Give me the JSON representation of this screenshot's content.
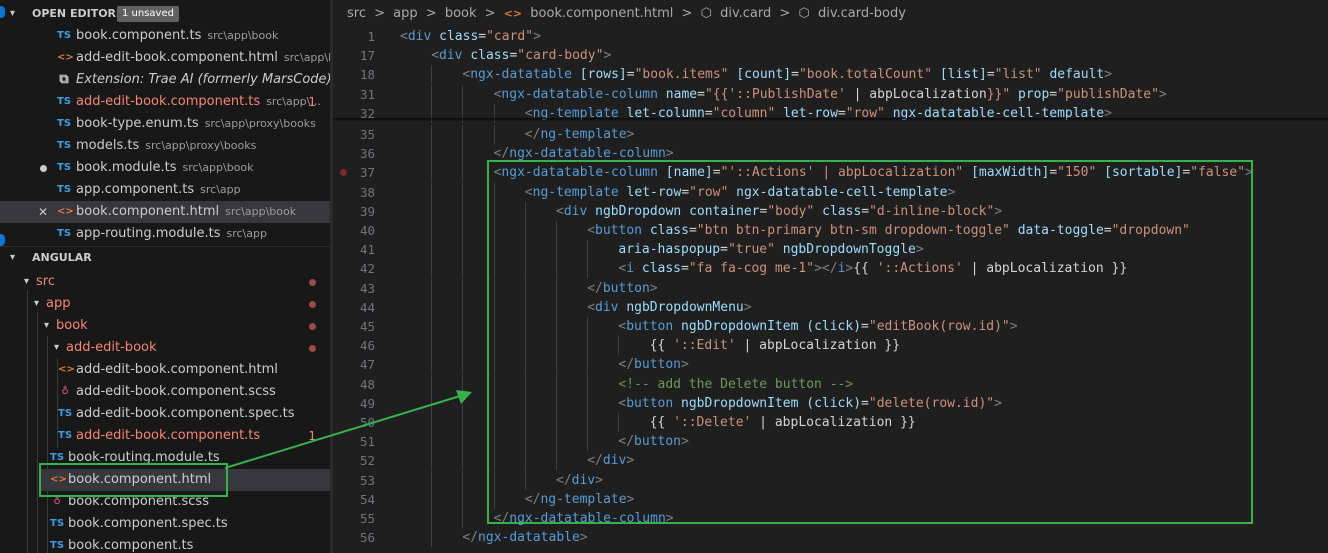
{
  "sidebar": {
    "open_editors": {
      "title": "OPEN EDITORS",
      "badge": "1 unsaved",
      "items": [
        {
          "icon": "TS",
          "type": "ts",
          "name": "book.component.ts",
          "path": "src\\app\\book"
        },
        {
          "icon": "<>",
          "type": "html",
          "name": "add-edit-book.component.html",
          "path": "src\\app\\bo..."
        },
        {
          "icon": "⧉",
          "type": "ext",
          "name": "Extension: Trae AI (formerly MarsCode): Co...",
          "path": ""
        },
        {
          "icon": "TS",
          "type": "ts",
          "name": "add-edit-book.component.ts",
          "path": "src\\app\\...",
          "count": "1",
          "error": true
        },
        {
          "icon": "TS",
          "type": "ts",
          "name": "book-type.enum.ts",
          "path": "src\\app\\proxy\\books"
        },
        {
          "icon": "TS",
          "type": "ts",
          "name": "models.ts",
          "path": "src\\app\\proxy\\books"
        },
        {
          "icon": "TS",
          "type": "ts",
          "name": "book.module.ts",
          "path": "src\\app\\book",
          "dirty": true
        },
        {
          "icon": "TS",
          "type": "ts",
          "name": "app.component.ts",
          "path": "src\\app"
        },
        {
          "icon": "<>",
          "type": "html",
          "name": "book.component.html",
          "path": "src\\app\\book",
          "selected": true,
          "close": "✕"
        },
        {
          "icon": "TS",
          "type": "ts",
          "name": "app-routing.module.ts",
          "path": "src\\app"
        }
      ]
    },
    "explorer": {
      "title": "ANGULAR",
      "items": [
        {
          "name": "src",
          "folder": true,
          "error": true
        },
        {
          "name": "app",
          "folder": true,
          "error": true
        },
        {
          "name": "book",
          "folder": true,
          "error": true
        },
        {
          "name": "add-edit-book",
          "folder": true,
          "error": true
        },
        {
          "icon": "<>",
          "type": "html",
          "name": "add-edit-book.component.html"
        },
        {
          "icon": "♁",
          "type": "scss",
          "name": "add-edit-book.component.scss"
        },
        {
          "icon": "TS",
          "type": "ts",
          "name": "add-edit-book.component.spec.ts"
        },
        {
          "icon": "TS",
          "type": "ts",
          "name": "add-edit-book.component.ts",
          "error": true,
          "count": "1"
        },
        {
          "icon": "TS",
          "type": "ts",
          "name": "book-routing.module.ts"
        },
        {
          "icon": "<>",
          "type": "html",
          "name": "book.component.html",
          "selected": true
        },
        {
          "icon": "♁",
          "type": "scss",
          "name": "book.component.scss"
        },
        {
          "icon": "TS",
          "type": "ts",
          "name": "book.component.spec.ts"
        },
        {
          "icon": "TS",
          "type": "ts",
          "name": "book.component.ts"
        }
      ]
    }
  },
  "breadcrumb": [
    "src",
    ">",
    "app",
    ">",
    "book",
    ">",
    "<>",
    "book.component.html",
    ">",
    "div.card",
    ">",
    "div.card-body"
  ],
  "code_lines": [
    {
      "n": "1",
      "indent": 0,
      "html": "<span class='br'>&lt;</span><span class='tag'>div</span> <span class='attr'>class</span><span class='pl'>=</span><span class='str'>\"card\"</span><span class='br'>&gt;</span>"
    },
    {
      "n": "17",
      "indent": 1,
      "html": "<span class='br'>&lt;</span><span class='tag'>div</span> <span class='attr'>class</span><span class='pl'>=</span><span class='str'>\"card-body\"</span><span class='br'>&gt;</span>"
    },
    {
      "n": "18",
      "indent": 2,
      "html": "<span class='br'>&lt;</span><span class='tag'>ngx-datatable</span> <span class='attr'>[rows]</span><span class='pl'>=</span><span class='str'>\"book.items\"</span> <span class='attr'>[count]</span><span class='pl'>=</span><span class='str'>\"book.totalCount\"</span> <span class='attr'>[list]</span><span class='pl'>=</span><span class='str'>\"list\"</span> <span class='attr'>default</span><span class='br'>&gt;</span>"
    },
    {
      "n": "31",
      "indent": 3,
      "html": "<span class='br'>&lt;</span><span class='tag'>ngx-datatable-column</span> <span class='attr'>name</span><span class='pl'>=</span><span class='str'>\"{{</span><span class='str'>'::PublishDate'</span><span class='pl'> | abpLocalization</span><span class='str'>}}\"</span> <span class='attr'>prop</span><span class='pl'>=</span><span class='str'>\"publishDate\"</span><span class='br'>&gt;</span>"
    },
    {
      "n": "32",
      "indent": 4,
      "html": "<span class='br'>&lt;</span><span class='tag'>ng-template</span> <span class='attr'>let-column</span><span class='pl'>=</span><span class='str'>\"column\"</span> <span class='attr'>let-row</span><span class='pl'>=</span><span class='str'>\"row\"</span> <span class='attr'>ngx-datatable-cell-template</span><span class='br'>&gt;</span>"
    },
    {
      "n": "35",
      "indent": 4,
      "html": "<span class='br'>&lt;/</span><span class='tag'>ng-template</span><span class='br'>&gt;</span>"
    },
    {
      "n": "36",
      "indent": 3,
      "html": "<span class='br'>&lt;/</span><span class='tag'>ngx-datatable-column</span><span class='br'>&gt;</span>"
    },
    {
      "n": "37",
      "indent": 3,
      "bp": true,
      "html": "<span class='br'>&lt;</span><span class='tag'>ngx-datatable-column</span> <span class='attr'>[name]</span><span class='pl'>=</span><span class='str'>\"'::Actions' | abpLocalization\"</span> <span class='attr'>[maxWidth]</span><span class='pl'>=</span><span class='str'>\"150\"</span> <span class='attr'>[sortable]</span><span class='pl'>=</span><span class='str'>\"false\"</span><span class='br'>&gt;</span>"
    },
    {
      "n": "38",
      "indent": 4,
      "html": "<span class='br'>&lt;</span><span class='tag'>ng-template</span> <span class='attr'>let-row</span><span class='pl'>=</span><span class='str'>\"row\"</span> <span class='attr'>ngx-datatable-cell-template</span><span class='br'>&gt;</span>"
    },
    {
      "n": "39",
      "indent": 5,
      "html": "<span class='br'>&lt;</span><span class='tag'>div</span> <span class='attr'>ngbDropdown</span> <span class='attr'>container</span><span class='pl'>=</span><span class='str'>\"body\"</span> <span class='attr'>class</span><span class='pl'>=</span><span class='str'>\"d-inline-block\"</span><span class='br'>&gt;</span>"
    },
    {
      "n": "40",
      "indent": 6,
      "html": "<span class='br'>&lt;</span><span class='tag'>button</span> <span class='attr'>class</span><span class='pl'>=</span><span class='str'>\"btn btn-primary btn-sm dropdown-toggle\"</span> <span class='attr'>data-toggle</span><span class='pl'>=</span><span class='str'>\"dropdown\"</span>"
    },
    {
      "n": "41",
      "indent": 7,
      "html": "<span class='attr'>aria-haspopup</span><span class='pl'>=</span><span class='str'>\"true\"</span> <span class='attr'>ngbDropdownToggle</span><span class='br'>&gt;</span>"
    },
    {
      "n": "42",
      "indent": 7,
      "html": "<span class='br'>&lt;</span><span class='tag'>i</span> <span class='attr'>class</span><span class='pl'>=</span><span class='str'>\"fa fa-cog me-1\"</span><span class='br'>&gt;&lt;/</span><span class='tag'>i</span><span class='br'>&gt;</span><span class='pl'>{{ </span><span class='str'>'::Actions'</span><span class='pl'> | abpLocalization }}</span>"
    },
    {
      "n": "43",
      "indent": 6,
      "html": "<span class='br'>&lt;/</span><span class='tag'>button</span><span class='br'>&gt;</span>"
    },
    {
      "n": "44",
      "indent": 6,
      "html": "<span class='br'>&lt;</span><span class='tag'>div</span> <span class='attr'>ngbDropdownMenu</span><span class='br'>&gt;</span>"
    },
    {
      "n": "45",
      "indent": 7,
      "html": "<span class='br'>&lt;</span><span class='tag'>button</span> <span class='attr'>ngbDropdownItem</span> <span class='attr'>(click)</span><span class='pl'>=</span><span class='str'>\"editBook(row.id)\"</span><span class='br'>&gt;</span>"
    },
    {
      "n": "46",
      "indent": 8,
      "html": "<span class='pl'>{{ </span><span class='str'>'::Edit'</span><span class='pl'> | abpLocalization }}</span>"
    },
    {
      "n": "47",
      "indent": 7,
      "html": "<span class='br'>&lt;/</span><span class='tag'>button</span><span class='br'>&gt;</span>"
    },
    {
      "n": "48",
      "indent": 7,
      "html": "<span class='cmt'>&lt;!-- add the Delete button --&gt;</span>"
    },
    {
      "n": "49",
      "indent": 7,
      "html": "<span class='br'>&lt;</span><span class='tag'>button</span> <span class='attr'>ngbDropdownItem</span> <span class='attr'>(click)</span><span class='pl'>=</span><span class='str'>\"delete(row.id)\"</span><span class='br'>&gt;</span>"
    },
    {
      "n": "50",
      "indent": 8,
      "html": "<span class='pl'>{{ </span><span class='str'>'::Delete'</span><span class='pl'> | abpLocalization }}</span>"
    },
    {
      "n": "51",
      "indent": 7,
      "html": "<span class='br'>&lt;/</span><span class='tag'>button</span><span class='br'>&gt;</span>"
    },
    {
      "n": "52",
      "indent": 6,
      "html": "<span class='br'>&lt;/</span><span class='tag'>div</span><span class='br'>&gt;</span>"
    },
    {
      "n": "53",
      "indent": 5,
      "html": "<span class='br'>&lt;/</span><span class='tag'>div</span><span class='br'>&gt;</span>"
    },
    {
      "n": "54",
      "indent": 4,
      "html": "<span class='br'>&lt;/</span><span class='tag'>ng-template</span><span class='br'>&gt;</span>"
    },
    {
      "n": "55",
      "indent": 3,
      "html": "<span class='br'>&lt;/</span><span class='tag'>ngx-datatable-column</span><span class='br'>&gt;</span>"
    },
    {
      "n": "56",
      "indent": 2,
      "html": "<span class='br'>&lt;/</span><span class='tag'>ngx-datatable</span><span class='br'>&gt;</span>"
    }
  ],
  "colors": {
    "annotation": "#36b24a",
    "ts": "#3c9ee6",
    "html": "#e37933",
    "scss": "#e05d88",
    "error": "#f48771"
  }
}
